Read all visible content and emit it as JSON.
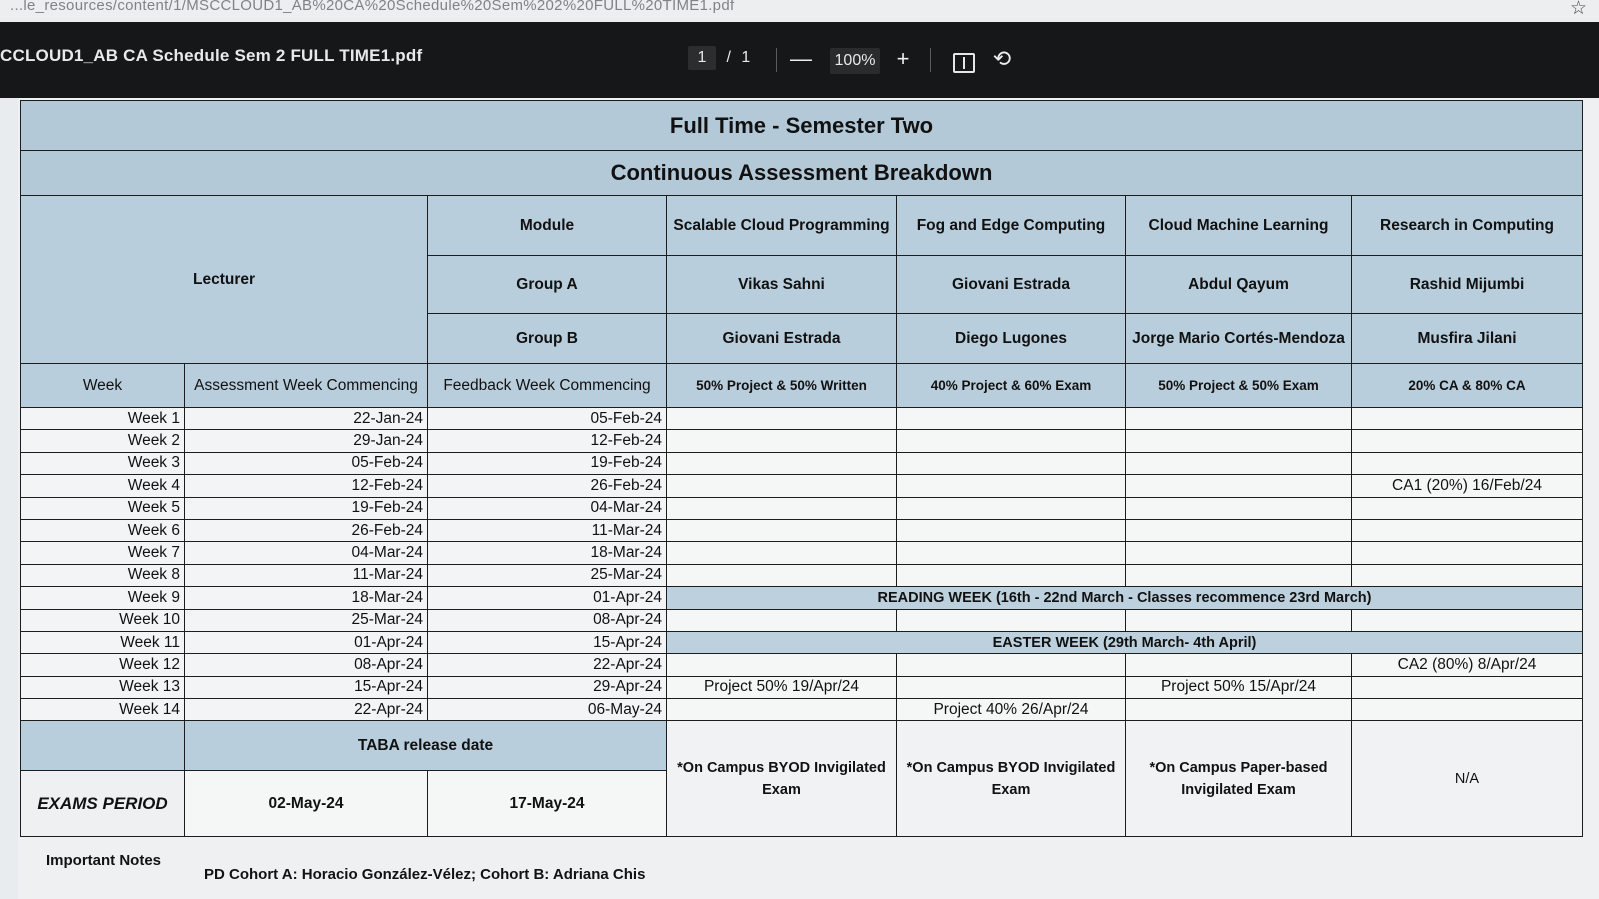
{
  "browser": {
    "url": "...le_resources/content/1/MSCCLOUD1_AB%20CA%20Schedule%20Sem%202%20FULL%20TIME1.pdf"
  },
  "viewer": {
    "file_title": "CCLOUD1_AB CA Schedule Sem 2 FULL TIME1.pdf",
    "page_current": "1",
    "page_separator": "/",
    "page_total": "1",
    "zoom_out_symbol": "—",
    "zoom": "100%",
    "zoom_in_symbol": "+",
    "rotate_symbol": "⟲"
  },
  "schedule": {
    "title": "Full Time - Semester Two",
    "subtitle": "Continuous Assessment Breakdown",
    "lecturer_label": "Lecturer",
    "module_label": "Module",
    "group_a_label": "Group A",
    "group_b_label": "Group B",
    "week_label": "Week",
    "assessment_week_label": "Assessment Week Commencing",
    "feedback_week_label": "Feedback Week Commencing",
    "modules": [
      {
        "name": "Scalable Cloud Programming",
        "group_a": "Vikas Sahni",
        "group_b": "Giovani Estrada",
        "weighting": "50% Project & 50% Written"
      },
      {
        "name": "Fog and Edge Computing",
        "group_a": "Giovani Estrada",
        "group_b": "Diego Lugones",
        "weighting": "40% Project & 60% Exam"
      },
      {
        "name": "Cloud Machine Learning",
        "group_a": "Abdul Qayum",
        "group_b": "Jorge Mario Cortés-Mendoza",
        "weighting": "50% Project & 50% Exam"
      },
      {
        "name": "Research in Computing",
        "group_a": "Rashid Mijumbi",
        "group_b": "Musfira Jilani",
        "weighting": "20% CA & 80% CA"
      }
    ],
    "weeks": [
      {
        "week": "Week 1",
        "assessment": "22-Jan-24",
        "feedback": "05-Feb-24",
        "m": [
          "",
          "",
          "",
          ""
        ]
      },
      {
        "week": "Week 2",
        "assessment": "29-Jan-24",
        "feedback": "12-Feb-24",
        "m": [
          "",
          "",
          "",
          ""
        ]
      },
      {
        "week": "Week 3",
        "assessment": "05-Feb-24",
        "feedback": "19-Feb-24",
        "m": [
          "",
          "",
          "",
          ""
        ]
      },
      {
        "week": "Week 4",
        "assessment": "12-Feb-24",
        "feedback": "26-Feb-24",
        "m": [
          "",
          "",
          "",
          "CA1 (20%) 16/Feb/24"
        ]
      },
      {
        "week": "Week 5",
        "assessment": "19-Feb-24",
        "feedback": "04-Mar-24",
        "m": [
          "",
          "",
          "",
          ""
        ]
      },
      {
        "week": "Week 6",
        "assessment": "26-Feb-24",
        "feedback": "11-Mar-24",
        "m": [
          "",
          "",
          "",
          ""
        ]
      },
      {
        "week": "Week 7",
        "assessment": "04-Mar-24",
        "feedback": "18-Mar-24",
        "m": [
          "",
          "",
          "",
          ""
        ]
      },
      {
        "week": "Week 8",
        "assessment": "11-Mar-24",
        "feedback": "25-Mar-24",
        "m": [
          "",
          "",
          "",
          ""
        ]
      },
      {
        "week": "Week 9",
        "assessment": "18-Mar-24",
        "feedback": "01-Apr-24",
        "band": "READING WEEK (16th - 22nd March - Classes recommence 23rd March)"
      },
      {
        "week": "Week 10",
        "assessment": "25-Mar-24",
        "feedback": "08-Apr-24",
        "m": [
          "",
          "",
          "",
          ""
        ]
      },
      {
        "week": "Week 11",
        "assessment": "01-Apr-24",
        "feedback": "15-Apr-24",
        "band": "EASTER WEEK (29th March- 4th April)"
      },
      {
        "week": "Week 12",
        "assessment": "08-Apr-24",
        "feedback": "22-Apr-24",
        "m": [
          "",
          "",
          "",
          "CA2 (80%) 8/Apr/24"
        ]
      },
      {
        "week": "Week 13",
        "assessment": "15-Apr-24",
        "feedback": "29-Apr-24",
        "m": [
          "Project 50% 19/Apr/24",
          "",
          "Project 50% 15/Apr/24",
          ""
        ]
      },
      {
        "week": "Week 14",
        "assessment": "22-Apr-24",
        "feedback": "06-May-24",
        "m": [
          "",
          "Project 40% 26/Apr/24",
          "",
          ""
        ]
      }
    ],
    "taba_label": "TABA release date",
    "exams_label": "EXAMS PERIOD",
    "exams_start": "02-May-24",
    "exams_end": "17-May-24",
    "exam_notes": [
      "*On Campus BYOD Invigilated Exam",
      "*On Campus BYOD Invigilated Exam",
      "*On Campus Paper-based Invigilated Exam",
      "N/A"
    ],
    "important_notes_label": "Important Notes",
    "cohort_line": "PD Cohort A: Horacio González-Vélez; Cohort B: Adriana Chis"
  }
}
